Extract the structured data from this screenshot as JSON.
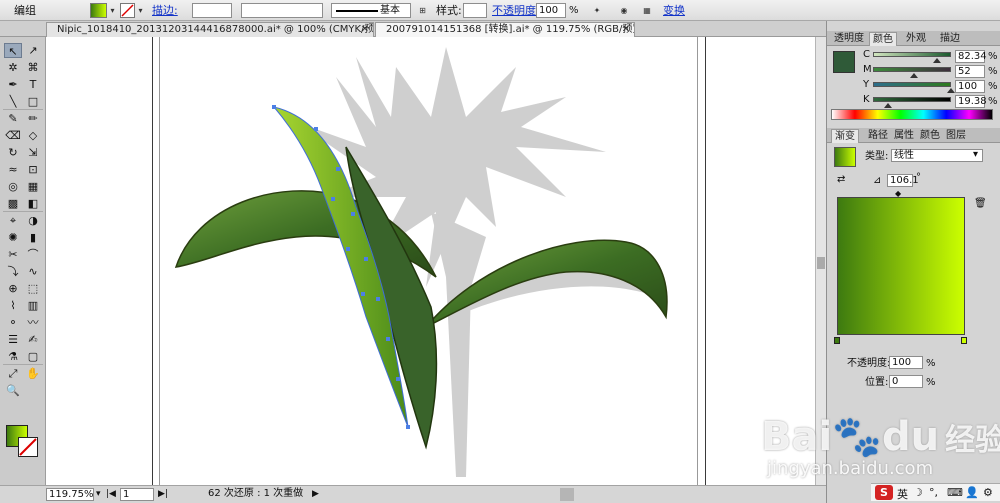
{
  "control_bar": {
    "group_label": "编组",
    "stroke_label": "描边:",
    "stroke_profile": "基本",
    "style_label": "样式:",
    "opacity_label": "不透明度:",
    "opacity_value": "100",
    "opacity_unit": "%",
    "transform_label": "变换"
  },
  "tabs": [
    {
      "label": "Nipic_1018410_20131203144416878000.ai* @ 100% (CMYK/预览)",
      "active": false
    },
    {
      "label": "2007910141513​68 [转换].ai* @ 119.75% (RGB/预览)",
      "active": true
    }
  ],
  "tools": [
    {
      "glyph": "↖",
      "name": "selection-tool"
    },
    {
      "glyph": "↗",
      "name": "direct-selection-tool"
    },
    {
      "glyph": "✲",
      "name": "magic-wand-tool"
    },
    {
      "glyph": "⌘",
      "name": "lasso-tool"
    },
    {
      "glyph": "✒",
      "name": "pen-tool"
    },
    {
      "glyph": "T",
      "name": "type-tool"
    },
    {
      "glyph": "╲",
      "name": "line-tool"
    },
    {
      "glyph": "□",
      "name": "rectangle-tool"
    },
    {
      "glyph": "✎",
      "name": "paintbrush-tool"
    },
    {
      "glyph": "✏",
      "name": "pencil-tool"
    },
    {
      "glyph": "⌫",
      "name": "blob-brush-tool"
    },
    {
      "glyph": "◇",
      "name": "eraser-tool"
    },
    {
      "glyph": "↻",
      "name": "rotate-tool"
    },
    {
      "glyph": "⇲",
      "name": "scale-tool"
    },
    {
      "glyph": "≈",
      "name": "warp-tool"
    },
    {
      "glyph": "⊡",
      "name": "free-transform-tool"
    },
    {
      "glyph": "◎",
      "name": "shape-builder-tool"
    },
    {
      "glyph": "▦",
      "name": "perspective-grid-tool"
    },
    {
      "glyph": "▩",
      "name": "mesh-tool"
    },
    {
      "glyph": "◧",
      "name": "gradient-tool"
    },
    {
      "glyph": "⌖",
      "name": "eyedropper-tool"
    },
    {
      "glyph": "◑",
      "name": "blend-tool"
    },
    {
      "glyph": "✺",
      "name": "symbol-sprayer-tool"
    },
    {
      "glyph": "▮",
      "name": "column-graph-tool"
    },
    {
      "glyph": "✂",
      "name": "scissors-tool"
    },
    {
      "glyph": "⌒",
      "name": "reshape-tool"
    },
    {
      "glyph": "⤵",
      "name": "width-tool"
    },
    {
      "glyph": "∿",
      "name": "twirl-tool"
    },
    {
      "glyph": "⊕",
      "name": "artboard-target-tool"
    },
    {
      "glyph": "⬚",
      "name": "artboard-tool"
    },
    {
      "glyph": "⌇",
      "name": "slice-tool"
    },
    {
      "glyph": "▥",
      "name": "bar-graph-tool"
    },
    {
      "glyph": "⚬",
      "name": "crystallize-tool"
    },
    {
      "glyph": "〰",
      "name": "wrinkle-tool"
    },
    {
      "glyph": "☰",
      "name": "chart-data-tool"
    },
    {
      "glyph": "✍",
      "name": "eyedropper-tool-2"
    },
    {
      "glyph": "⚗",
      "name": "paint-bucket-tool"
    },
    {
      "glyph": "▢",
      "name": "crop-tool"
    },
    {
      "glyph": "⤢",
      "name": "knife-tool"
    },
    {
      "glyph": "✋",
      "name": "hand-tool"
    },
    {
      "glyph": "🔍",
      "name": "zoom-tool"
    }
  ],
  "status": {
    "zoom": "119.75%",
    "page": "1",
    "history": "62 次还原 : 1 次重做"
  },
  "color_panel": {
    "tabs": [
      "透明度",
      "颜色",
      "外观",
      "描边"
    ],
    "channels": [
      {
        "label": "C",
        "value": "82.34",
        "unit": "%",
        "level": 0.82
      },
      {
        "label": "M",
        "value": "52",
        "unit": "%",
        "level": 0.52
      },
      {
        "label": "Y",
        "value": "100",
        "unit": "%",
        "level": 1.0
      },
      {
        "label": "K",
        "value": "19.38",
        "unit": "%",
        "level": 0.19
      }
    ],
    "fill_color": "#2f5a38"
  },
  "gradient_panel": {
    "tabs": [
      "渐变",
      "路径",
      "属性",
      "颜色",
      "图层"
    ],
    "type_label": "类型:",
    "type_value": "线性",
    "angle_value": "106.1",
    "angle_unit": "°",
    "opacity_label": "不透明度:",
    "opacity_value": "100",
    "opacity_unit": "%",
    "location_label": "位置:",
    "location_value": "0",
    "location_unit": "%",
    "color_start": "#3d7a10",
    "color_end": "#ccff00"
  },
  "watermark": {
    "brand": "Bai",
    "brand_suffix": "du",
    "product": "经验",
    "url": "jingyan.baidu.com"
  },
  "tray": {
    "lang": "英"
  }
}
